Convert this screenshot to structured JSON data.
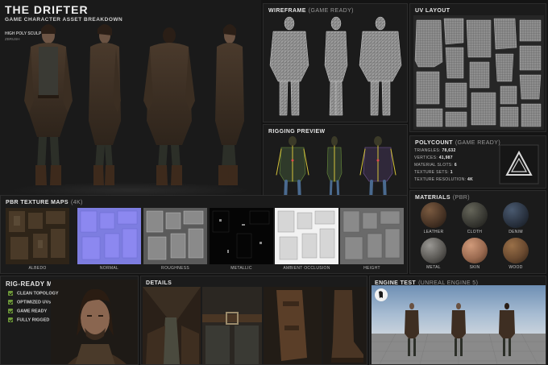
{
  "header": {
    "title": "THE DRIFTER",
    "subtitle": "GAME CHARACTER ASSET BREAKDOWN",
    "sculpt_label": "HIGH POLY SCULPT",
    "sculpt_sub": "ZBRUSH"
  },
  "wireframe": {
    "title": "WIREFRAME",
    "sub": "(GAME READY)"
  },
  "uv": {
    "title": "UV LAYOUT"
  },
  "rigging": {
    "title": "RIGGING PREVIEW"
  },
  "polycount": {
    "title": "POLYCOUNT",
    "sub": "(GAME READY)",
    "stats": [
      {
        "label": "TRIANGLES:",
        "value": "78,632"
      },
      {
        "label": "VERTICES:",
        "value": "41,987"
      },
      {
        "label": "MATERIAL SLOTS:",
        "value": "6"
      },
      {
        "label": "TEXTURE SETS:",
        "value": "1"
      },
      {
        "label": "TEXTURE RESOLUTION:",
        "value": "4K"
      }
    ]
  },
  "textures": {
    "title": "PBR TEXTURE MAPS",
    "sub": "(4K)",
    "maps": [
      "ALBEDO",
      "NORMAL",
      "ROUGHNESS",
      "METALLIC",
      "AMBIENT OCCLUSION",
      "HEIGHT"
    ]
  },
  "materials": {
    "title": "MATERIALS",
    "sub": "(PBR)",
    "items": [
      "LEATHER",
      "CLOTH",
      "DENIM",
      "METAL",
      "SKIN",
      "WOOD"
    ],
    "colors": [
      "#4a3526",
      "#3a3a34",
      "#2b3442",
      "#5c5a56",
      "#9a6a50",
      "#6a4a30"
    ]
  },
  "rig_ready": {
    "title": "RIG-READY MESH",
    "items": [
      "CLEAN TOPOLOGY",
      "OPTIMIZED UVs",
      "GAME READY",
      "FULLY RIGGED"
    ]
  },
  "details": {
    "title": "DETAILS"
  },
  "engine": {
    "title": "ENGINE TEST",
    "sub": "(UNREAL ENGINE 5)"
  }
}
